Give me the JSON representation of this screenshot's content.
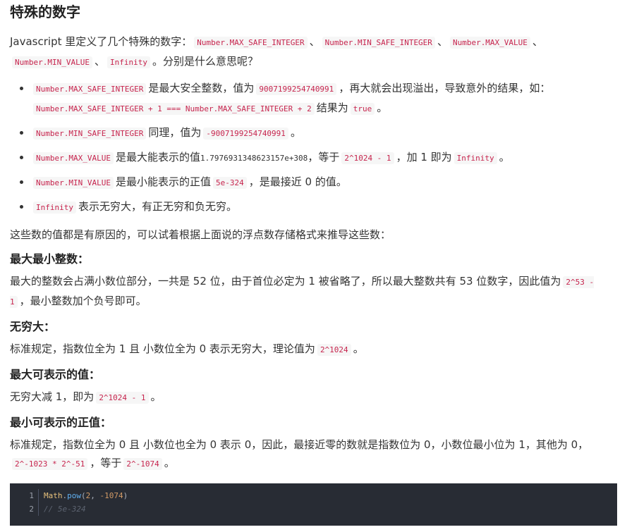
{
  "title": "特殊的数字",
  "intro": {
    "prefix": "Javascript 里定义了几个特殊的数字：",
    "codes": [
      "Number.MAX_SAFE_INTEGER",
      "Number.MIN_SAFE_INTEGER",
      "Number.MAX_VALUE",
      "Number.MIN_VALUE",
      "Infinity"
    ],
    "sep": "、",
    "suffix": "。分别是什么意思呢？"
  },
  "list": [
    {
      "c1": "Number.MAX_SAFE_INTEGER",
      "t1": "是最大安全整数，值为",
      "c2": "9007199254740991",
      "t2": "，再大就会出现溢出，导致意外的结果，如：",
      "c3": "Number.MAX_SAFE_INTEGER + 1 === Number.MAX_SAFE_INTEGER + 2",
      "t3": "结果为",
      "c4": "true",
      "t4": "。"
    },
    {
      "c1": "Number.MIN_SAFE_INTEGER",
      "t1": "同理，值为",
      "c2": "-9007199254740991",
      "t2": "。"
    },
    {
      "c1": "Number.MAX_VALUE",
      "t1": "是最大能表示的值",
      "v": "1.7976931348623157e+308",
      "t2": "，等于",
      "c2": "2^1024 - 1",
      "t3": "，加 1 即为",
      "c3": "Infinity",
      "t4": "。"
    },
    {
      "c1": "Number.MIN_VALUE",
      "t1": "是最小能表示的正值",
      "c2": "5e-324",
      "t2": "，是最接近 0 的值。"
    },
    {
      "c1": "Infinity",
      "t1": "表示无穷大，有正无穷和负无穷。"
    }
  ],
  "after_list": "这些数的值都是有原因的，可以试着根据上面说的浮点数存储格式来推导这些数：",
  "sections": {
    "max_min_int": {
      "heading": "最大最小整数：",
      "text1": "最大的整数会占满小数位部分，一共是 52 位，由于首位必定为 1 被省略了，所以最大整数共有 53 位数字，因此值为",
      "code": "2^53 - 1",
      "text2": "，最小整数加个负号即可。"
    },
    "infinity": {
      "heading": "无穷大：",
      "text1": "标准规定，指数位全为 1 且 小数位全为 0 表示无穷大，理论值为",
      "code": "2^1024",
      "text2": "。"
    },
    "max_value": {
      "heading": "最大可表示的值：",
      "text1": "无穷大减 1，即为",
      "code": "2^1024 - 1",
      "text2": "。"
    },
    "min_value": {
      "heading": "最小可表示的正值：",
      "text1": "标准规定，指数位全为 0 且 小数位也全为 0 表示 0，因此，最接近零的数就是指数位为 0，小数位最小位为 1，其他为 0，",
      "code1": "2^-1023 * 2^-51",
      "text2": "，等于",
      "code2": "2^-1074",
      "text3": "。"
    }
  },
  "codeblock": {
    "line_numbers": [
      "1",
      "2"
    ],
    "line1": {
      "obj": "Math",
      "dot": ".",
      "fn": "pow",
      "open": "(",
      "a": "2",
      "comma": ", ",
      "b": "-1074",
      "close": ")"
    },
    "line2": "// 5e-324"
  }
}
